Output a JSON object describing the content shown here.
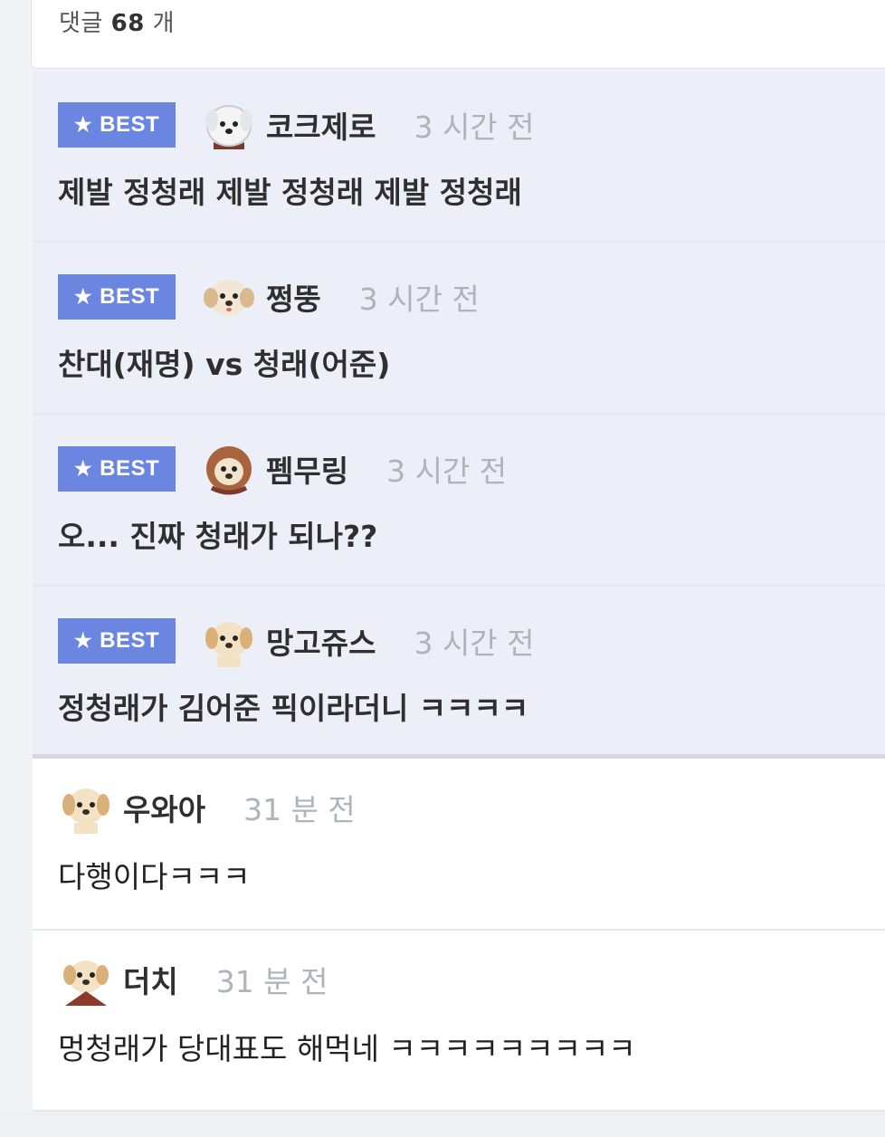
{
  "header": {
    "count_label": "댓글",
    "count_value": "68",
    "count_unit": "개"
  },
  "best_comments": [
    {
      "badge": "BEST",
      "nickname": "코크제로",
      "time": "3 시간 전",
      "text": "제발 정청래 제발 정청래 제발 정청래",
      "avatar_icon": "dog-avatar-icon"
    },
    {
      "badge": "BEST",
      "nickname": "쩡뚱",
      "time": "3 시간 전",
      "text": "찬대(재명) vs 청래(어준)",
      "avatar_icon": "dog-avatar-icon"
    },
    {
      "badge": "BEST",
      "nickname": "펨무링",
      "time": "3 시간 전",
      "text": "오... 진짜 청래가 되나??",
      "avatar_icon": "dog-avatar-icon"
    },
    {
      "badge": "BEST",
      "nickname": "망고쥬스",
      "time": "3 시간 전",
      "text": "정청래가 김어준 픽이라더니 ㅋㅋㅋㅋ",
      "avatar_icon": "dog-avatar-icon"
    }
  ],
  "comments": [
    {
      "nickname": "우와아",
      "time": "31 분 전",
      "text": "다행이다ㅋㅋㅋ",
      "avatar_icon": "dog-avatar-icon"
    },
    {
      "nickname": "더치",
      "time": "31 분 전",
      "text": "멍청래가 당대표도 해먹네 ㅋㅋㅋㅋㅋㅋㅋㅋㅋ",
      "avatar_icon": "dog-avatar-icon"
    }
  ],
  "colors": {
    "best_badge": "#6a86e0",
    "best_background": "#eceff7",
    "time_text": "#b0b3b9"
  }
}
